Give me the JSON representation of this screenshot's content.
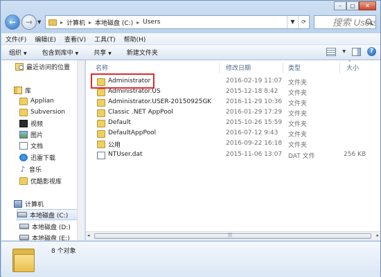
{
  "window": {
    "controls": {
      "minimize": "–",
      "maximize": "□",
      "close": "✕"
    }
  },
  "address": {
    "crumbs": [
      "计算机",
      "本地磁盘 (C:)",
      "Users"
    ],
    "search_placeholder": "搜索 Users"
  },
  "menu": [
    "文件(F)",
    "编辑(E)",
    "查看(V)",
    "工具(T)",
    "帮助(H)"
  ],
  "toolbar": {
    "organize": "组织",
    "include_in_library": "包含到库中",
    "share": "共享",
    "new_folder": "新建文件夹"
  },
  "sidebar": {
    "items": [
      {
        "label": "最近访问的位置",
        "icon": "recent-places-icon"
      },
      {
        "label": "库",
        "icon": "library-icon"
      },
      {
        "label": "Applian",
        "icon": "folder-icon"
      },
      {
        "label": "Subversion",
        "icon": "folder-icon"
      },
      {
        "label": "视频",
        "icon": "video-library-icon"
      },
      {
        "label": "图片",
        "icon": "pictures-library-icon"
      },
      {
        "label": "文档",
        "icon": "documents-library-icon"
      },
      {
        "label": "迅雷下载",
        "icon": "xunlei-download-icon"
      },
      {
        "label": "音乐",
        "icon": "music-library-icon"
      },
      {
        "label": "优酷影视库",
        "icon": "folder-icon"
      },
      {
        "label": "计算机",
        "icon": "computer-icon"
      },
      {
        "label": "本地磁盘 (C:)",
        "icon": "drive-icon"
      },
      {
        "label": "本地磁盘 (D:)",
        "icon": "drive-icon"
      },
      {
        "label": "本地磁盘 (E:)",
        "icon": "drive-icon"
      }
    ]
  },
  "columns": {
    "name": "名称",
    "modified": "修改日期",
    "type": "类型",
    "size": "大小"
  },
  "files": [
    {
      "name": "Administrator",
      "modified": "2016-02-19 11:07",
      "type": "文件夹",
      "size": ""
    },
    {
      "name": "Administrator.US",
      "modified": "2015-12-18 8:42",
      "type": "文件夹",
      "size": ""
    },
    {
      "name": "Administrator.USER-20150925GK",
      "modified": "2016-11-29 10:36",
      "type": "文件夹",
      "size": ""
    },
    {
      "name": "Classic .NET AppPool",
      "modified": "2016-01-29 17:29",
      "type": "文件夹",
      "size": ""
    },
    {
      "name": "Default",
      "modified": "2015-10-26 15:59",
      "type": "文件夹",
      "size": ""
    },
    {
      "name": "DefaultAppPool",
      "modified": "2016-07-12 9:43",
      "type": "文件夹",
      "size": ""
    },
    {
      "name": "公用",
      "modified": "2016-09-22 16:18",
      "type": "文件夹",
      "size": ""
    },
    {
      "name": "NTUser.dat",
      "modified": "2015-11-06 13:07",
      "type": "DAT 文件",
      "size": "256 KB"
    }
  ],
  "status": {
    "item_count": "8 个对象"
  },
  "colors": {
    "highlight": "#e2282c",
    "folder": "#efcf63",
    "header_text": "#4f6989"
  }
}
